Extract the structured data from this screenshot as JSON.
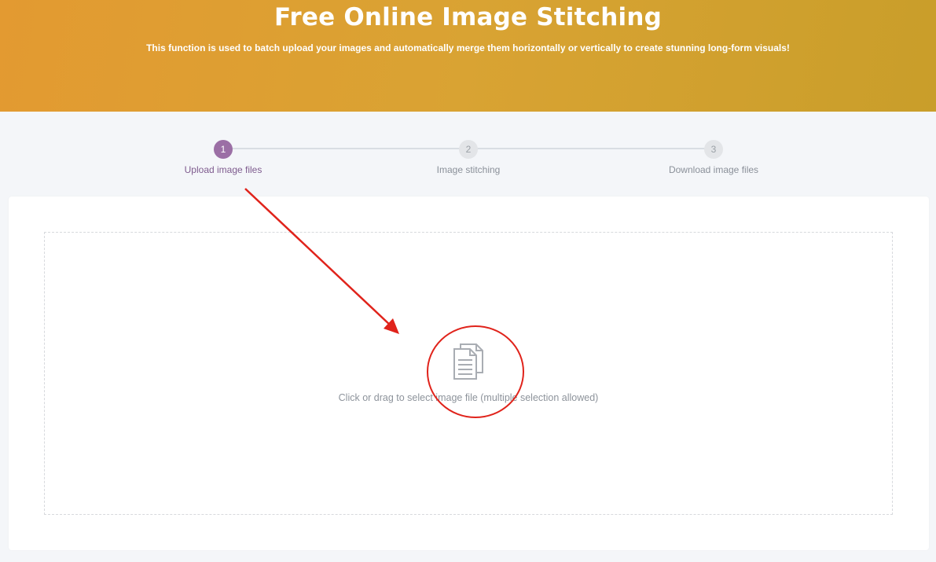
{
  "hero": {
    "title": "Free Online Image Stitching",
    "subtitle": "This function is used to batch upload your images and automatically merge them horizontally or vertically to create stunning long-form visuals!"
  },
  "steps": [
    {
      "number": "1",
      "label": "Upload image files",
      "active": true
    },
    {
      "number": "2",
      "label": "Image stitching",
      "active": false
    },
    {
      "number": "3",
      "label": "Download image files",
      "active": false
    }
  ],
  "dropzone": {
    "icon": "document-stack-icon",
    "text": "Click or drag to select image file (multiple selection allowed)"
  },
  "colors": {
    "hero_start": "#e39a31",
    "hero_end": "#c99e2a",
    "active_step": "#9b6fa5",
    "annotation": "#e0231b"
  }
}
